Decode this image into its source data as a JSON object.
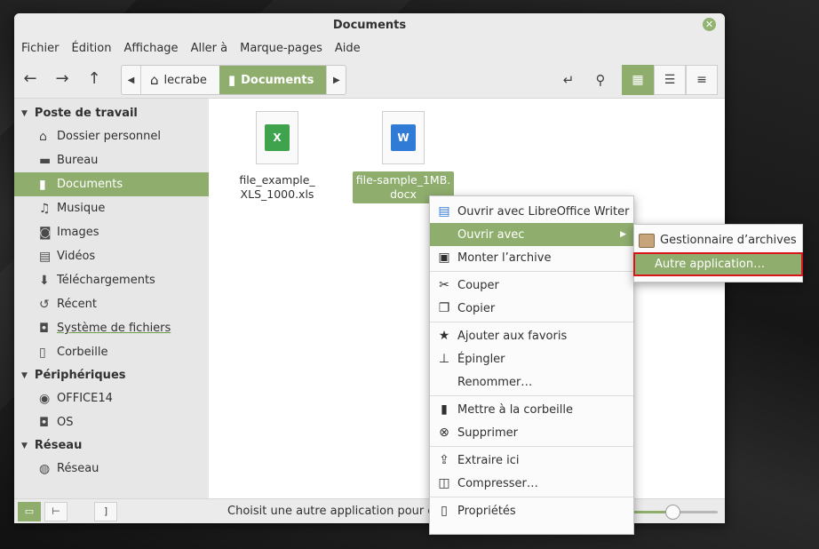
{
  "window": {
    "title": "Documents"
  },
  "menubar": [
    "Fichier",
    "Édition",
    "Affichage",
    "Aller à",
    "Marque-pages",
    "Aide"
  ],
  "pathbar": {
    "home": "lecrabe",
    "current": "Documents"
  },
  "sidebar": {
    "sections": [
      {
        "title": "Poste de travail",
        "items": [
          {
            "label": "Dossier personnel",
            "icon": "home-icon"
          },
          {
            "label": "Bureau",
            "icon": "desktop-icon"
          },
          {
            "label": "Documents",
            "icon": "document-icon",
            "active": true
          },
          {
            "label": "Musique",
            "icon": "music-icon"
          },
          {
            "label": "Images",
            "icon": "camera-icon"
          },
          {
            "label": "Vidéos",
            "icon": "film-icon"
          },
          {
            "label": "Téléchargements",
            "icon": "download-icon"
          },
          {
            "label": "Récent",
            "icon": "history-icon"
          },
          {
            "label": "Système de fichiers",
            "icon": "drive-icon"
          },
          {
            "label": "Corbeille",
            "icon": "trash-icon"
          }
        ]
      },
      {
        "title": "Périphériques",
        "items": [
          {
            "label": "OFFICE14",
            "icon": "disc-icon"
          },
          {
            "label": "OS",
            "icon": "drive-icon"
          }
        ]
      },
      {
        "title": "Réseau",
        "items": [
          {
            "label": "Réseau",
            "icon": "network-icon"
          }
        ]
      }
    ]
  },
  "files": [
    {
      "name_line1": "file_example_",
      "name_line2": "XLS_1000.xls",
      "badge": "X",
      "color": "#3fa34d"
    },
    {
      "name_line1": "file-sample_1MB.",
      "name_line2": "docx",
      "badge": "W",
      "color": "#2f7bd6",
      "selected": true
    }
  ],
  "context_menu": {
    "items": [
      "Ouvrir avec LibreOffice Writer",
      "Ouvrir avec",
      "Monter l’archive",
      "Couper",
      "Copier",
      "Ajouter aux favoris",
      "Épingler",
      "Renommer…",
      "Mettre à la corbeille",
      "Supprimer",
      "Extraire ici",
      "Compresser…",
      "Propriétés"
    ]
  },
  "submenu": {
    "items": [
      "Gestionnaire d’archives",
      "Autre application…"
    ]
  },
  "statusbar": {
    "text": "Choisit une autre application pour ouvrir l'é"
  },
  "colors": {
    "accent": "#8fae6e",
    "highlight_border": "#d9141b"
  }
}
